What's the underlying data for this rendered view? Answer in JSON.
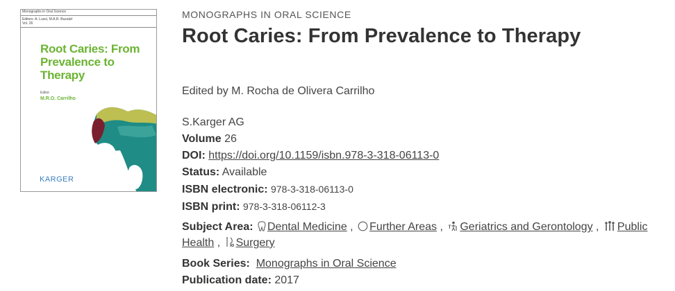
{
  "cover": {
    "band_lines": [
      "Monographs in Oral Science",
      "Editors: A. Lussi, M.A.R. Buzalaf",
      "Vol. 26"
    ],
    "title": "Root Caries: From Prevalence to Therapy",
    "editor_label": "Editor",
    "editor": "M.R.O. Carrilho",
    "publisher": "KARGER",
    "colors": {
      "title": "#6bb433",
      "publisher": "#3b7fbf",
      "art_teal": "#1f8c86"
    }
  },
  "book": {
    "series": "MONOGRAPHS IN ORAL SCIENCE",
    "title": "Root Caries: From Prevalence to Therapy",
    "edited_by": "Edited by M. Rocha de Olivera Carrilho",
    "publisher": "S.Karger AG",
    "volume_label": "Volume",
    "volume": "26",
    "doi_label": "DOI:",
    "doi": "https://doi.org/10.1159/isbn.978-3-318-06113-0",
    "status_label": "Status:",
    "status": "Available",
    "isbn_e_label": "ISBN electronic:",
    "isbn_e": "978-3-318-06113-0",
    "isbn_p_label": "ISBN print:",
    "isbn_p": "978-3-318-06112-3"
  },
  "subject": {
    "label": "Subject Area:",
    "items": [
      {
        "label": "Dental Medicine",
        "icon": "tooth-icon"
      },
      {
        "label": "Further Areas",
        "icon": "circle-icon"
      },
      {
        "label": "Geriatrics and Gerontology",
        "icon": "elderly-icon"
      },
      {
        "label": "Public Health",
        "icon": "people-icon"
      },
      {
        "label": "Surgery",
        "icon": "surgery-icon"
      }
    ]
  },
  "series_row": {
    "label": "Book Series:",
    "value": "Monographs in Oral Science"
  },
  "pubdate": {
    "label": "Publication date:",
    "value": "2017"
  }
}
